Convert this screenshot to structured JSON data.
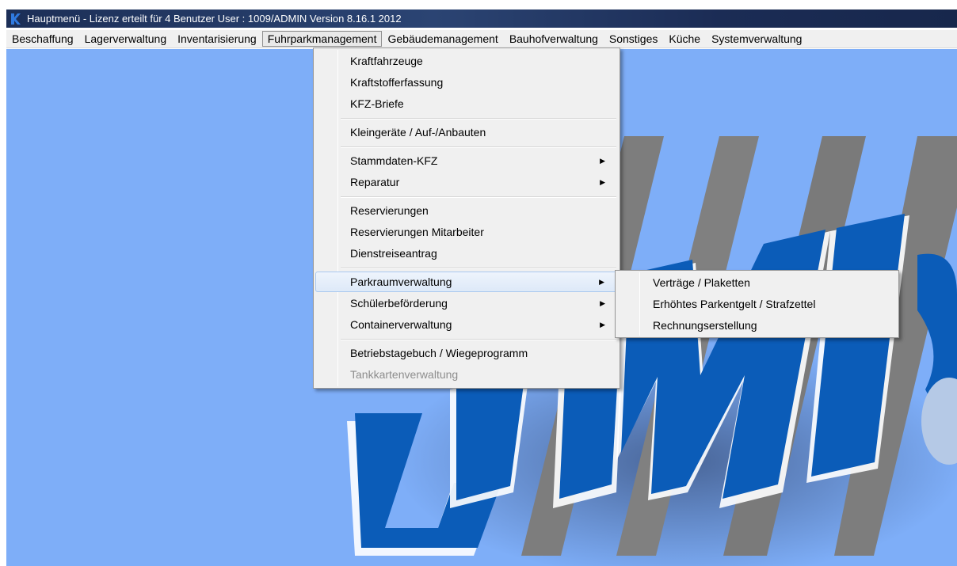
{
  "window": {
    "title": "Hauptmenü - Lizenz erteilt für 4 Benutzer   User : 1009/ADMIN   Version 8.16.1 2012"
  },
  "menubar": {
    "items": [
      "Beschaffung",
      "Lagerverwaltung",
      "Inventarisierung",
      "Fuhrparkmanagement",
      "Gebäudemanagement",
      "Bauhofverwaltung",
      "Sonstiges",
      "Küche",
      "Systemverwaltung"
    ],
    "active_index": 3
  },
  "dropdown": {
    "items": [
      "Kraftfahrzeuge",
      "Kraftstofferfassung",
      "KFZ-Briefe",
      "Kleingeräte / Auf-/Anbauten",
      "Stammdaten-KFZ",
      "Reparatur",
      "Reservierungen",
      "Reservierungen Mitarbeiter",
      "Dienstreiseantrag",
      "Parkraumverwaltung",
      "Schülerbeförderung",
      "Containerverwaltung",
      "Betriebstagebuch / Wiegeprogramm",
      "Tankkartenverwaltung"
    ],
    "submenu_arrow": "▶"
  },
  "submenu": {
    "items": [
      "Verträge / Plaketten",
      "Erhöhtes Parkentgelt / Strafzettel",
      "Rechnungserstellung"
    ]
  },
  "colors": {
    "desktop": "#7eaef8",
    "logo_blue": "#0b5cb8",
    "logo_gray": "#7d7d7d",
    "titlebar": "#2b4473"
  },
  "icons": {
    "app": "k-logo-icon",
    "submenu": "submenu-arrow-icon"
  }
}
